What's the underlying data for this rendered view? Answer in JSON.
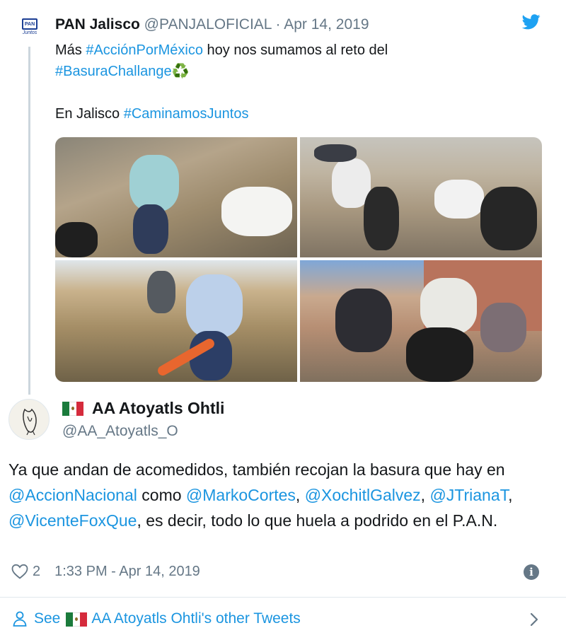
{
  "parent_tweet": {
    "name": "PAN Jalisco",
    "handle": "@PANJALOFICIAL",
    "separator": "·",
    "date": "Apr 14, 2019",
    "avatar": {
      "top_text": "PAN",
      "bottom_text": "Juntos"
    },
    "line1_pre": "Más ",
    "line1_hashtag": "#AcciónPorMéxico",
    "line1_post": " hoy nos sumamos al reto del",
    "line2_hashtag": "#BasuraChallange",
    "recycle_icon": "♻️",
    "line3_pre": "En Jalisco ",
    "line3_hashtag": "#CaminamosJuntos"
  },
  "reply_tweet": {
    "name": "AA Atoyatls Ohtli",
    "handle": "@AA_Atoyatls_O",
    "text_1": "Ya que andan de acomedidos, también recojan la basura que hay en ",
    "mention_1": "@AccionNacional",
    "text_2": " como ",
    "mention_2": "@MarkoCortes",
    "text_3": ", ",
    "mention_3": "@XochitlGalvez",
    "text_4": ", ",
    "mention_4": "@JTrianaT",
    "text_5": ", ",
    "mention_5": "@VicenteFoxQue",
    "text_6": ", es decir, todo lo que huela a podrido en el P.A.N.",
    "likes": "2",
    "timestamp": "1:33 PM - Apr 14, 2019"
  },
  "footer": {
    "see_label": "See",
    "other_tweets_label": "AA Atoyatls Ohtli's other Tweets"
  },
  "colors": {
    "link": "#1b95e0",
    "secondary_text": "#657786",
    "primary_text": "#14171a",
    "twitter_blue": "#1da1f2"
  },
  "icons": [
    "twitter-bird-icon",
    "recycle-icon",
    "mexico-flag-icon",
    "heart-icon",
    "info-icon",
    "person-icon",
    "chevron-right-icon"
  ]
}
